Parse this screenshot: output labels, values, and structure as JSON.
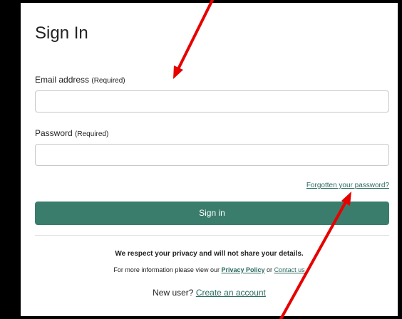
{
  "form": {
    "title": "Sign In",
    "email_label": "Email address",
    "email_required": "(Required)",
    "email_value": "",
    "password_label": "Password",
    "password_required": "(Required)",
    "password_value": "",
    "forgot_link": "Forgotten your password?",
    "submit_label": "Sign in"
  },
  "footer": {
    "privacy_statement": "We respect your privacy and will not share your details.",
    "info_prefix": "For more information please view our",
    "privacy_link": "Privacy Policy",
    "info_or": "or",
    "contact_link": "Contact us",
    "new_user_prefix": "New user?",
    "create_account_link": "Create an account"
  },
  "annotations": {
    "arrow_color": "#e60000"
  },
  "colors": {
    "accent": "#3a7d6c",
    "link": "#2a6a5e",
    "frame": "#000000"
  }
}
